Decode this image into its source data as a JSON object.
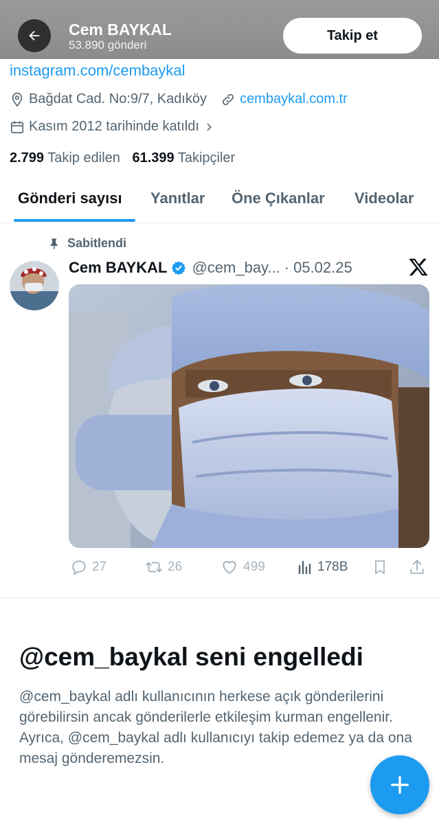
{
  "header": {
    "name": "Cem BAYKAL",
    "post_count": "53.890 gönderi",
    "follow_label": "Takip et"
  },
  "profile": {
    "link": "instagram.com/cembaykal",
    "location": "Bağdat Cad. No:9/7, Kadıköy",
    "website": "cembaykal.com.tr",
    "joined": "Kasım 2012 tarihinde katıldı",
    "following_count": "2.799",
    "following_label": "Takip edilen",
    "followers_count": "61.399",
    "followers_label": "Takipçiler"
  },
  "tabs": [
    {
      "label": "Gönderi sayısı",
      "active": true
    },
    {
      "label": "Yanıtlar",
      "active": false
    },
    {
      "label": "Öne Çıkanlar",
      "active": false
    },
    {
      "label": "Videolar",
      "active": false
    }
  ],
  "pinned_tweet": {
    "pinned_label": "Sabitlendi",
    "author": "Cem BAYKAL",
    "handle": "@cem_bay...",
    "separator": "·",
    "date": "05.02.25",
    "replies": "27",
    "retweets": "26",
    "likes": "499",
    "views": "178B"
  },
  "blocked": {
    "title": "@cem_baykal seni engelledi",
    "description": "@cem_baykal adlı kullanıcının herkese açık gönderilerini görebilirsin ancak gönderilerle etkileşim kurman engellenir. Ayrıca, @cem_baykal adlı kullanıcıyı takip edemez ya da ona mesaj gönderemezsin."
  },
  "icons": {
    "back": "back-arrow-icon",
    "location": "location-pin-icon",
    "link": "link-icon",
    "calendar": "calendar-icon",
    "pin": "pin-icon",
    "verified": "verified-badge-icon",
    "x_logo": "x-logo-icon",
    "reply": "reply-icon",
    "retweet": "retweet-icon",
    "like": "like-icon",
    "views": "views-icon",
    "bookmark": "bookmark-icon",
    "share": "share-icon",
    "compose": "compose-plus-icon"
  },
  "colors": {
    "accent": "#1d9bf0",
    "text_primary": "#0f1419",
    "text_secondary": "#536471"
  }
}
